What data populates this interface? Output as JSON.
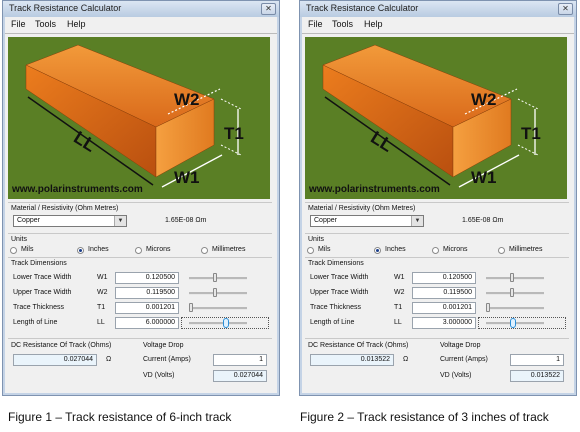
{
  "windows": [
    {
      "title": "Track Resistance Calculator",
      "menu": [
        "File",
        "Tools",
        "Help"
      ],
      "picture": {
        "website": "www.polarinstruments.com",
        "dim_labels": [
          "W2",
          "T1",
          "LL",
          "W1"
        ]
      },
      "material": {
        "label": "Material / Resistivity (Ohm Metres)",
        "selected": "Copper",
        "resistivity": "1.65E-08 Ωm"
      },
      "units": {
        "label": "Units",
        "options": [
          "Mils",
          "Inches",
          "Microns",
          "Millimetres"
        ],
        "selected": "Inches"
      },
      "dimensions": {
        "label": "Track Dimensions",
        "rows": [
          {
            "name": "Lower Trace Width",
            "symbol": "W1",
            "value": "0.120500",
            "slider": 0.45
          },
          {
            "name": "Upper Trace Width",
            "symbol": "W2",
            "value": "0.119500",
            "slider": 0.45
          },
          {
            "name": "Trace Thickness",
            "symbol": "T1",
            "value": "0.001201",
            "slider": 0.04
          },
          {
            "name": "Length of Line",
            "symbol": "LL",
            "value": "6.000000",
            "slider": 0.62
          }
        ]
      },
      "dc_resistance": {
        "label": "DC Resistance Of Track (Ohms)",
        "value": "0.027044",
        "unit": "Ω"
      },
      "voltage_drop": {
        "label": "Voltage Drop",
        "current_label": "Current (Amps)",
        "current": "1",
        "vd_label": "VD (Volts)",
        "vd": "0.027044"
      }
    },
    {
      "title": "Track Resistance Calculator",
      "menu": [
        "File",
        "Tools",
        "Help"
      ],
      "picture": {
        "website": "www.polarinstruments.com",
        "dim_labels": [
          "W2",
          "T1",
          "LL",
          "W1"
        ]
      },
      "material": {
        "label": "Material / Resistivity (Ohm Metres)",
        "selected": "Copper",
        "resistivity": "1.65E-08 Ωm"
      },
      "units": {
        "label": "Units",
        "options": [
          "Mils",
          "Inches",
          "Microns",
          "Millimetres"
        ],
        "selected": "Inches"
      },
      "dimensions": {
        "label": "Track Dimensions",
        "rows": [
          {
            "name": "Lower Trace Width",
            "symbol": "W1",
            "value": "0.120500",
            "slider": 0.45
          },
          {
            "name": "Upper Trace Width",
            "symbol": "W2",
            "value": "0.119500",
            "slider": 0.45
          },
          {
            "name": "Trace Thickness",
            "symbol": "T1",
            "value": "0.001201",
            "slider": 0.04
          },
          {
            "name": "Length of Line",
            "symbol": "LL",
            "value": "3.000000",
            "slider": 0.45
          }
        ]
      },
      "dc_resistance": {
        "label": "DC Resistance Of Track (Ohms)",
        "value": "0.013522",
        "unit": "Ω"
      },
      "voltage_drop": {
        "label": "Voltage Drop",
        "current_label": "Current (Amps)",
        "current": "1",
        "vd_label": "VD (Volts)",
        "vd": "0.013522"
      }
    }
  ],
  "captions": [
    "Figure 1 – Track resistance of 6-inch track",
    "Figure 2 – Track resistance of 3 inches of track"
  ],
  "colors": {
    "board": "#5a7f25",
    "copper": "#e67a1a",
    "window_frame": "#c4d3e6"
  }
}
